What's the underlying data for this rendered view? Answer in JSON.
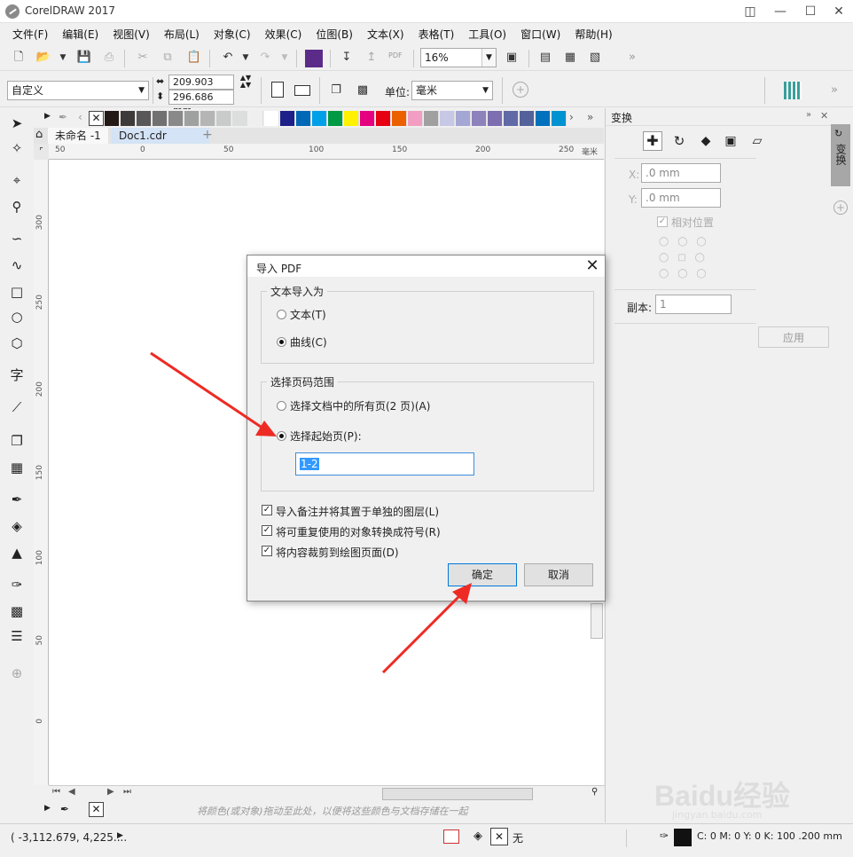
{
  "window": {
    "title": "CorelDRAW 2017"
  },
  "menu": [
    "文件(F)",
    "编辑(E)",
    "视图(V)",
    "布局(L)",
    "对象(C)",
    "效果(C)",
    "位图(B)",
    "文本(X)",
    "表格(T)",
    "工具(O)",
    "窗口(W)",
    "帮助(H)"
  ],
  "toolbar": {
    "zoom": "16%",
    "pdf_label": "PDF"
  },
  "property_bar": {
    "page_preset": "自定义",
    "width": "209.903 mm",
    "height": "296.686 mm",
    "unit_label": "单位:",
    "unit_value": "毫米"
  },
  "tabs": {
    "doc1": "未命名 -1",
    "doc2": "Doc1.cdr"
  },
  "ruler_top": [
    "50",
    "0",
    "50",
    "100",
    "150",
    "200",
    "250",
    "毫米"
  ],
  "ruler_left": [
    "300",
    "250",
    "200",
    "150",
    "100",
    "50",
    "0"
  ],
  "tools": {
    "text_tool": "字"
  },
  "palette_hint": "将颜色(或对象)拖动至此处，以便将这些颜色与文档存储在一起",
  "palette_colors": [
    "#231916",
    "#3e3a39",
    "#595757",
    "#727171",
    "#898989",
    "#9fa0a0",
    "#b5b5b6",
    "#c9caca",
    "#dcdddd",
    "#efefef",
    "#ffffff",
    "#1d2088",
    "#0068b7",
    "#00a0e9",
    "#009944",
    "#fff100",
    "#e4007f",
    "#e60012",
    "#eb6100",
    "#f19ec2",
    "#a0a0a0",
    "#c7c8e6",
    "#a4a7d4",
    "#8e82bc",
    "#7c6eb0",
    "#5f6aa6",
    "#54629b",
    "#0071bc",
    "#0092d1"
  ],
  "dialog": {
    "title": "导入 PDF",
    "group1": "文本导入为",
    "opt_text": "文本(T)",
    "opt_curve": "曲线(C)",
    "group2": "选择页码范围",
    "opt_all": "选择文档中的所有页(2 页)(A)",
    "opt_start": "选择起始页(P):",
    "page_range": "1-2",
    "cb1": "导入备注并将其置于单独的图层(L)",
    "cb2": "将可重复使用的对象转换成符号(R)",
    "cb3": "将内容裁剪到绘图页面(D)",
    "ok": "确定",
    "cancel": "取消"
  },
  "docker": {
    "title": "变换",
    "x_label": "X:",
    "x_value": ".0 mm",
    "y_label": "Y:",
    "y_value": ".0 mm",
    "relative": "相对位置",
    "copies_label": "副本:",
    "copies_value": "1",
    "apply": "应用",
    "side_tab": "变换"
  },
  "status": {
    "coords": "( -3,112.679, 4,225....",
    "fill_none": "无",
    "outline": "C: 0 M: 0 Y: 0 K: 100  .200 mm"
  },
  "watermark": {
    "brand": "Baidu经验",
    "url": "jingyan.baidu.com"
  },
  "colors": {
    "accent_arrow": "#ee2a24",
    "selection_blue": "#3399ff"
  }
}
